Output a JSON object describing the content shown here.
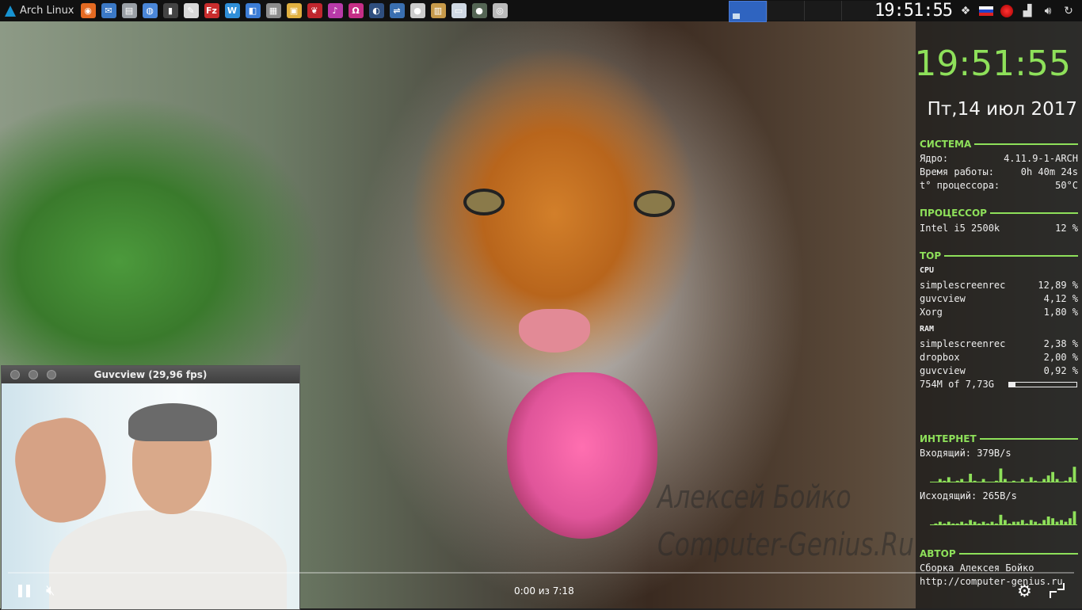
{
  "taskbar": {
    "start_label": "Arch Linux",
    "launchers": [
      {
        "icon": "firefox-icon",
        "color": "#e46a22",
        "glyph": "◉"
      },
      {
        "icon": "thunderbird-icon",
        "color": "#3b79c6",
        "glyph": "✉"
      },
      {
        "icon": "files-icon",
        "color": "#9aa0a6",
        "glyph": "▤"
      },
      {
        "icon": "chromium-icon",
        "color": "#4a86d8",
        "glyph": "◍"
      },
      {
        "icon": "terminal-icon",
        "color": "#444444",
        "glyph": "▮"
      },
      {
        "icon": "text-editor-icon",
        "color": "#d9d9d9",
        "glyph": "✎"
      },
      {
        "icon": "filezilla-icon",
        "color": "#c92d2d",
        "glyph": "Fz"
      },
      {
        "icon": "writer-icon",
        "color": "#2f8fd8",
        "glyph": "W"
      },
      {
        "icon": "document-icon",
        "color": "#3c7dd6",
        "glyph": "◧"
      },
      {
        "icon": "calc-icon",
        "color": "#8c8c8c",
        "glyph": "▦"
      },
      {
        "icon": "image-viewer-icon",
        "color": "#e0b040",
        "glyph": "▣"
      },
      {
        "icon": "cherrytree-icon",
        "color": "#c0262d",
        "glyph": "❦"
      },
      {
        "icon": "music-player-icon",
        "color": "#b83aa8",
        "glyph": "♪"
      },
      {
        "icon": "headphones-icon",
        "color": "#c52e86",
        "glyph": "Ω"
      },
      {
        "icon": "globe-icon",
        "color": "#2f4f7f",
        "glyph": "◐"
      },
      {
        "icon": "network-icon",
        "color": "#3a6fb0",
        "glyph": "⇌"
      },
      {
        "icon": "system-monitor-icon",
        "color": "#cccccc",
        "glyph": "●"
      },
      {
        "icon": "archive-icon",
        "color": "#c79a4a",
        "glyph": "▥"
      },
      {
        "icon": "window-icon",
        "color": "#cfd8e3",
        "glyph": "▭"
      },
      {
        "icon": "recorder-icon",
        "color": "#556655",
        "glyph": "●"
      },
      {
        "icon": "webcam-icon",
        "color": "#bbbbbb",
        "glyph": "◎"
      }
    ]
  },
  "tray": {
    "clock": "19:51:55",
    "icons": [
      "dropbox-icon",
      "flag-ru-icon",
      "record-icon",
      "signal-icon",
      "volume-icon",
      "refresh-icon"
    ]
  },
  "conky": {
    "time": "19:51:55",
    "date": "Пт,14 июл 2017",
    "system": {
      "title": "СИСТЕМА",
      "rows": [
        {
          "label": "Ядро:",
          "value": "4.11.9-1-ARCH"
        },
        {
          "label": "Время работы:",
          "value": "0h 40m 24s"
        },
        {
          "label": "t° процессора:",
          "value": "50°C"
        }
      ]
    },
    "cpu": {
      "title": "ПРОЦЕССОР",
      "rows": [
        {
          "label": "Intel i5 2500k",
          "value": "12 %"
        }
      ]
    },
    "top": {
      "title": "TOP",
      "cpu_label": "CPU",
      "cpu_rows": [
        {
          "label": "simplescreenrec",
          "value": "12,89 %"
        },
        {
          "label": "guvcview",
          "value": "4,12 %"
        },
        {
          "label": "Xorg",
          "value": "1,80 %"
        }
      ],
      "ram_label": "RAM",
      "ram_rows": [
        {
          "label": "simplescreenrec",
          "value": "2,38 %"
        },
        {
          "label": "dropbox",
          "value": "2,00 %"
        },
        {
          "label": "guvcview",
          "value": "0,92 %"
        }
      ],
      "ram_usage": "754M of 7,73G",
      "ram_fraction": 0.095
    },
    "internet": {
      "title": "ИНТЕРНЕТ",
      "incoming": "Входящий: 379B/s",
      "outgoing": "Исходящий: 265B/s",
      "incoming_levels": [
        0,
        0,
        0.2,
        0.1,
        0.3,
        0,
        0.1,
        0.2,
        0,
        0.5,
        0.1,
        0,
        0.2,
        0,
        0,
        0.1,
        0.8,
        0.2,
        0,
        0.1,
        0,
        0.2,
        0,
        0.3,
        0.1,
        0,
        0.2,
        0.4,
        0.6,
        0.2,
        0,
        0.1,
        0.3,
        0.9
      ],
      "outgoing_levels": [
        0,
        0.1,
        0.2,
        0.1,
        0.2,
        0.1,
        0.1,
        0.2,
        0.1,
        0.3,
        0.2,
        0.1,
        0.2,
        0.1,
        0.2,
        0.1,
        0.6,
        0.3,
        0.1,
        0.2,
        0.2,
        0.3,
        0.1,
        0.3,
        0.2,
        0.1,
        0.3,
        0.5,
        0.4,
        0.2,
        0.3,
        0.2,
        0.4,
        0.8
      ]
    },
    "author": {
      "title": "АВТОР",
      "name": "Сборка Алексея Бойко",
      "url": "http://computer-genius.ru"
    }
  },
  "wallpaper": {
    "watermark_line1": "Алексей Бойко",
    "watermark_line2": "Computer-Genius.Ru"
  },
  "guvcview": {
    "title": "Guvcview  (29,96 fps)"
  },
  "player": {
    "time": "0:00 из 7:18",
    "progress": 0.0
  },
  "colors": {
    "accent": "#8ee05a",
    "panel": "#111111"
  }
}
